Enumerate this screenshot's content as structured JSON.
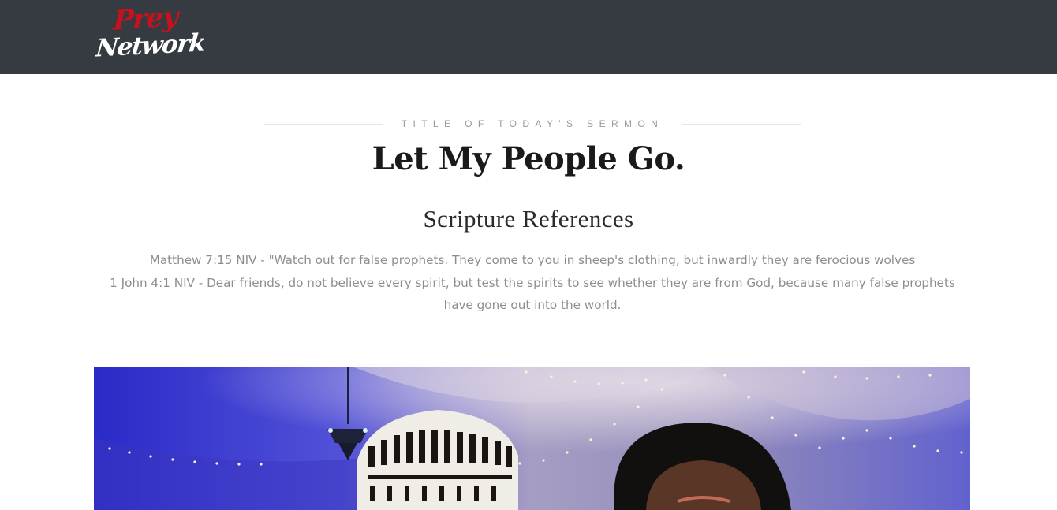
{
  "header": {
    "logo": {
      "line1": "Prey",
      "line2": "Network",
      "colors": {
        "line1": "#c8111c",
        "line2": "#ffffff",
        "bar": "#363a41"
      }
    }
  },
  "main": {
    "eyebrow": "TITLE OF TODAY'S SERMON",
    "title": "Let My People Go.",
    "scripture_heading": "Scripture References",
    "scriptures": [
      "Matthew 7:15 NIV - \"Watch out for false prophets. They come to you in sheep's clothing, but inwardly they are ferocious wolves",
      "1 John 4:1 NIV - Dear friends, do not believe every spirit, but test the spirits to see whether they are from God, because many false prophets have gone out into the world."
    ]
  }
}
